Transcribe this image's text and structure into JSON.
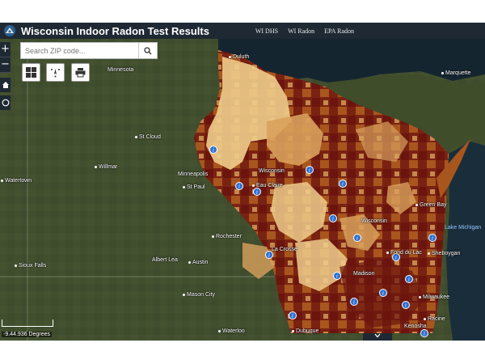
{
  "header": {
    "title": "Wisconsin Indoor Radon Test Results",
    "links": [
      "WI DHS",
      "WI Radon",
      "EPA Radon"
    ]
  },
  "search": {
    "placeholder": "Search ZIP code..."
  },
  "zoom": {
    "in": "+",
    "out": "−"
  },
  "toolbar": {
    "items": [
      "basemap-gallery-icon",
      "locate-icon",
      "print-icon"
    ]
  },
  "scale": {
    "coordinates": "-9.44.936 Degrees"
  },
  "map_labels": {
    "duluth": "Duluth",
    "minnesota": "Minnesota",
    "marquette": "Marquette",
    "st_cloud": "St Cloud",
    "willmar": "Willmar",
    "watertown": "Watertown",
    "minneapolis": "Minneapolis",
    "st_paul": "St Paul",
    "wisconsin_1": "Wisconsin",
    "eau_claire": "Eau Claire",
    "wisconsin_2": "Wisconsin",
    "green_bay": "Green Bay",
    "lake_michigan": "Lake Michigan",
    "rochester": "Rochester",
    "la_crosse": "La Crosse",
    "fond_du_lac": "Fond du Lac",
    "sheboygan": "Sheboygan",
    "sioux_falls": "Sioux Falls",
    "albert_lea": "Albert Lea",
    "austin": "Austin",
    "madison": "Madison",
    "milwaukee": "Milwaukee",
    "mason_city": "Mason City",
    "racine": "Racine",
    "waterloo": "Waterloo",
    "dubuque": "Dubuque",
    "kenosha": "Kenosha"
  },
  "colors": {
    "header": "#1f2933",
    "radon_low": "#f0cd8c",
    "radon_mid_low": "#d9a15c",
    "radon_mid_high": "#a85a1e",
    "radon_high": "#6b150e",
    "marker": "#2f6fd1"
  }
}
